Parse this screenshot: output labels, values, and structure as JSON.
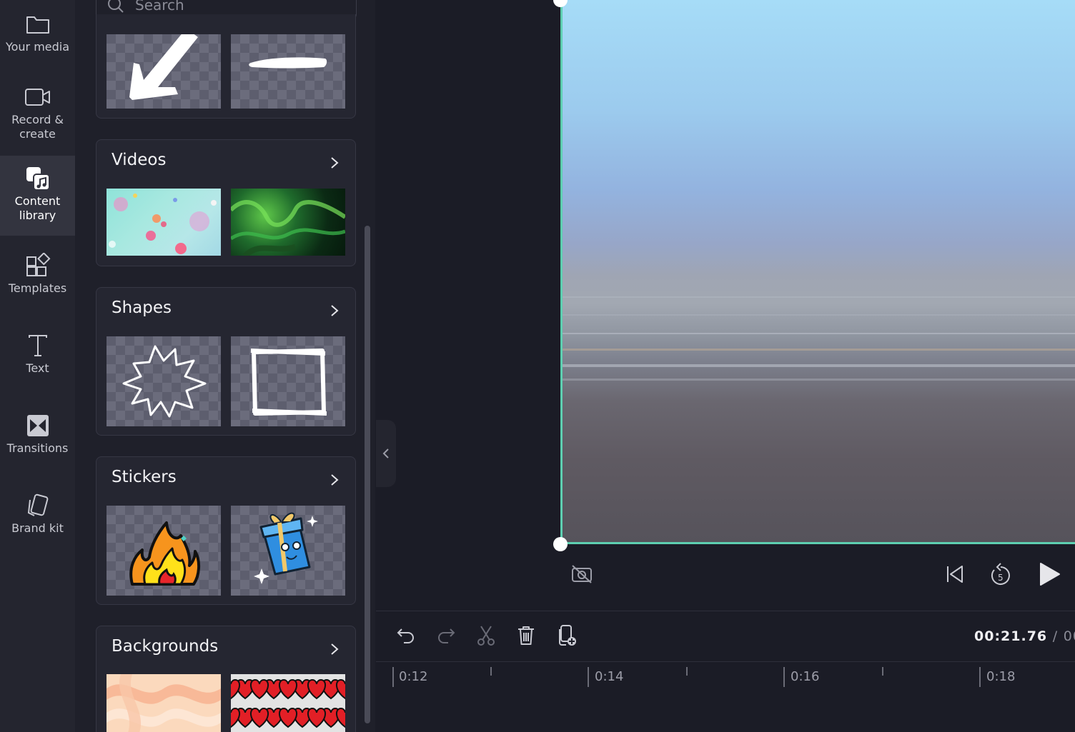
{
  "nav": {
    "items": [
      {
        "label": "Your media",
        "icon": "folder-icon"
      },
      {
        "label": "Record &\ncreate",
        "icon": "camera-icon"
      },
      {
        "label": "Content\nlibrary",
        "icon": "content-library-icon",
        "active": true
      },
      {
        "label": "Templates",
        "icon": "templates-icon"
      },
      {
        "label": "Text",
        "icon": "text-icon"
      },
      {
        "label": "Transitions",
        "icon": "transitions-icon"
      },
      {
        "label": "Brand kit",
        "icon": "brand-kit-icon"
      }
    ]
  },
  "search": {
    "placeholder": "Search"
  },
  "sections": [
    {
      "title": "Videos"
    },
    {
      "title": "Shapes"
    },
    {
      "title": "Stickers"
    },
    {
      "title": "Backgrounds"
    }
  ],
  "timeline": {
    "current_time": "00:21.76",
    "separator": "/",
    "total_time_partial": "00",
    "ticks": [
      "0:12",
      "0:14",
      "0:16",
      "0:18"
    ]
  },
  "colors": {
    "accent": "#5ecfb1",
    "background": "#1b1c26",
    "panel": "#1f202a",
    "nav": "#24252f"
  }
}
